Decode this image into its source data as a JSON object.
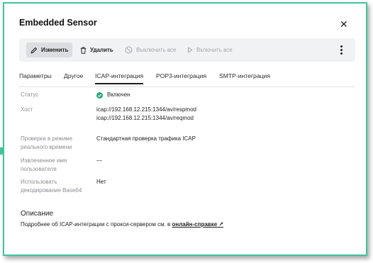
{
  "dialog": {
    "title": "Embedded Sensor"
  },
  "toolbar": {
    "edit_label": "Изменить",
    "delete_label": "Удалить",
    "disable_all_label": "Выключить все",
    "enable_all_label": "Включить все"
  },
  "tabs": [
    {
      "label": "Параметры"
    },
    {
      "label": "Другое"
    },
    {
      "label": "ICAP-интеграция"
    },
    {
      "label": "POP3-интеграция"
    },
    {
      "label": "SMTP-интеграция"
    }
  ],
  "active_tab": "ICAP-интеграция",
  "fields": {
    "status": {
      "label": "Статус",
      "value": "Включен"
    },
    "host": {
      "label": "Хост",
      "values": [
        "icap://192.168.12.215:1344/av/respmod",
        "icap://192.168.12.215:1344/av/reqmod"
      ]
    },
    "realtime_check": {
      "label_lines": [
        "Проверка в режиме",
        "реального времени"
      ],
      "value": "Стандартная проверка трафика ICAP"
    },
    "extracted_user": {
      "label_lines": [
        "Извлеченное имя",
        "пользователя"
      ],
      "value": "—"
    },
    "base64": {
      "label_lines": [
        "Использовать",
        "декодирование Base64"
      ],
      "value": "Нет"
    }
  },
  "description": {
    "title": "Описание",
    "text": "Подробнее об ICAP-интеграции с прокси-сервером см. в ",
    "link_label": "онлайн-справке ↗"
  },
  "colors": {
    "accent_frame": "#3fc39a",
    "status_ok": "#2aa87a",
    "toolbar_bg": "#f1f2f3"
  }
}
